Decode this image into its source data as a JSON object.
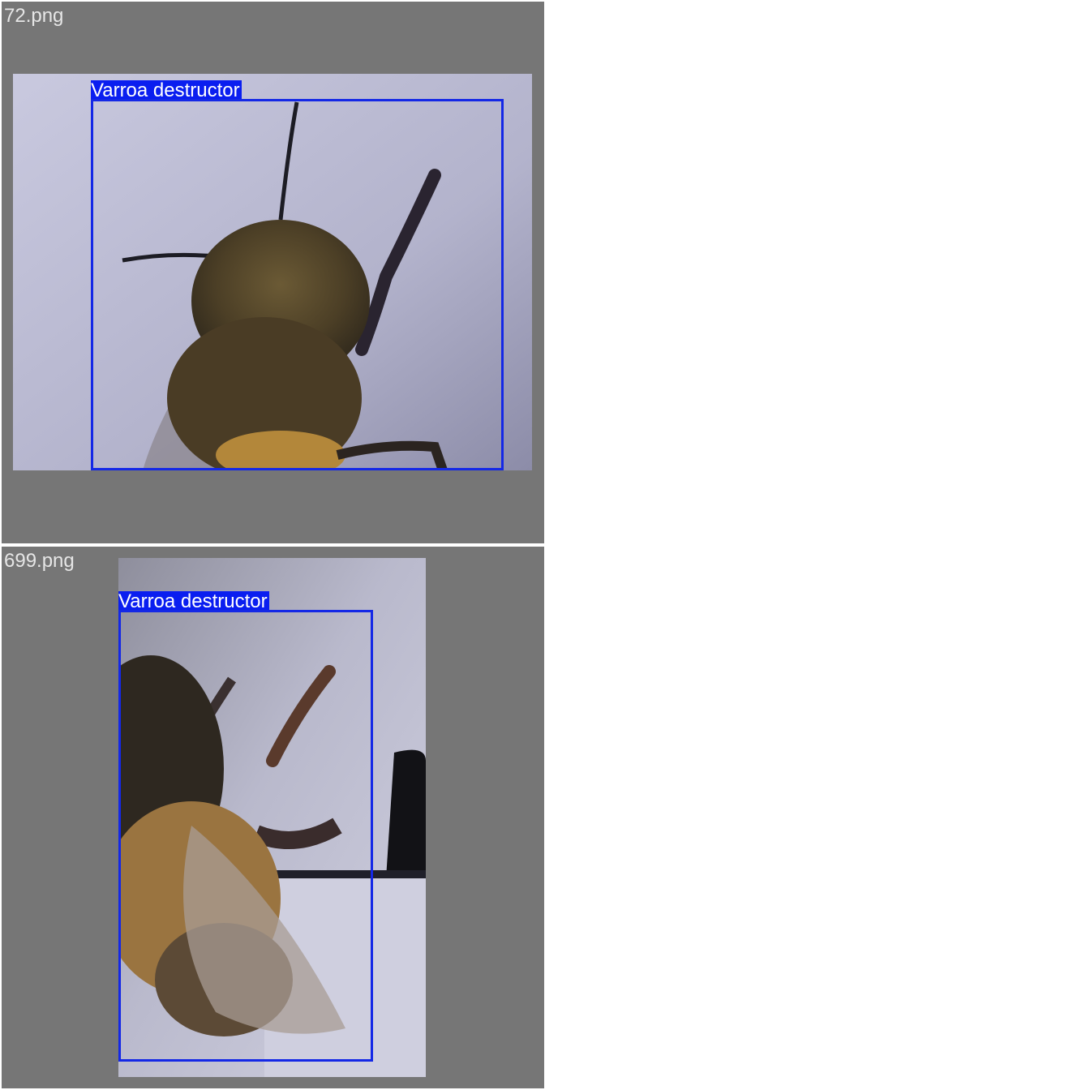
{
  "tiles": [
    {
      "filename": "72.png",
      "detection": {
        "label": "Varroa destructor"
      }
    },
    {
      "filename": "699.png",
      "detection": {
        "label": "Varroa destructor"
      }
    }
  ],
  "colors": {
    "tile_background": "#767676",
    "box_stroke": "#1428e6",
    "label_background": "#0a1ef0",
    "filename_text": "#e6e6e6"
  }
}
